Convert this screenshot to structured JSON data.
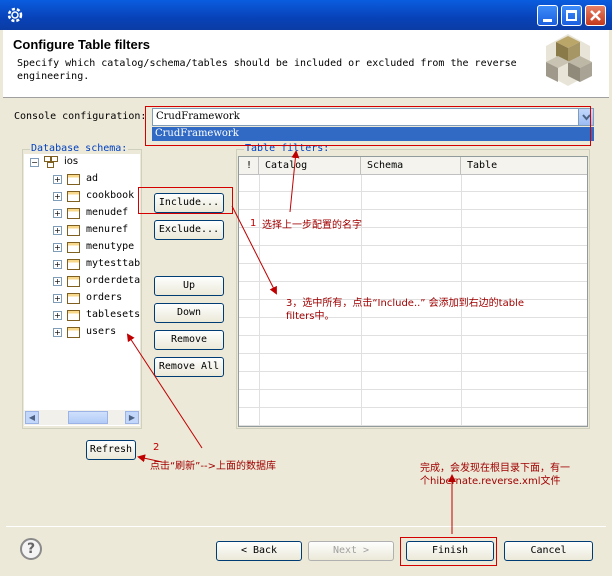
{
  "header": {
    "title": "Configure Table filters",
    "description": "Specify which catalog/schema/tables should be included or excluded from the reverse engineering."
  },
  "console": {
    "label": "Console configuration:",
    "value": "CrudFramework",
    "dropdown_option": "CrudFramework"
  },
  "schema": {
    "label": "Database schema:",
    "root": "ios",
    "items": [
      "ad",
      "cookbook",
      "menudef",
      "menuref",
      "menutype",
      "mytesttab",
      "orderdeta",
      "orders",
      "tablesets",
      "users"
    ]
  },
  "buttons": {
    "include": "Include...",
    "exclude": "Exclude...",
    "up": "Up",
    "down": "Down",
    "remove": "Remove",
    "remove_all": "Remove All",
    "refresh": "Refresh"
  },
  "filters": {
    "label": "Table filters:",
    "columns": [
      "!",
      "Catalog",
      "Schema",
      "Table"
    ]
  },
  "annotations": {
    "a1_num": "1",
    "a1_text": "选择上一步配置的名字",
    "a2_num": "2",
    "a2_text": "点击“刷新”-->上面的数据库",
    "a3_line1": "3，选中所有，点击“Include..” 会添加到右边的table",
    "a3_line2": "filters中。",
    "a4_line1": "完成，会发现在根目录下面，有一",
    "a4_line2": "个hibernate.reverse.xml文件"
  },
  "footer": {
    "back": "< Back",
    "next": "Next >",
    "finish": "Finish",
    "cancel": "Cancel"
  },
  "colors": {
    "titlebar": "#0a5ddf",
    "annotation": "#c00000",
    "selection": "#316ac5"
  }
}
